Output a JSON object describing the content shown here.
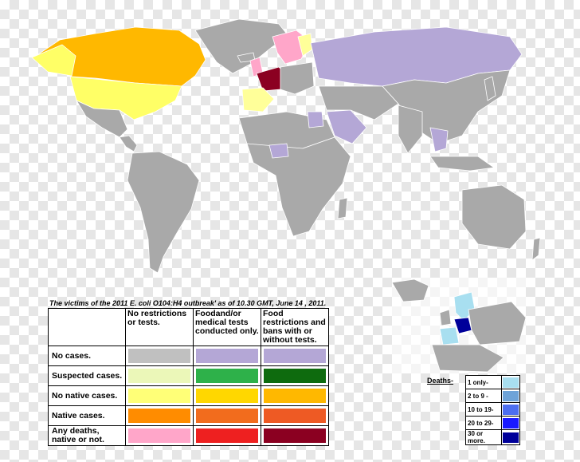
{
  "legend": {
    "caption": "The victims of the  2011 E. coli O104:H4 outbreak' as of 10.30 GMT, June 14 , 2011.",
    "columns": [
      "No restrictions or tests.",
      "Foodand/or medical tests conducted only.",
      "Food restrictions and bans with or without tests."
    ],
    "rows": [
      {
        "label": "No cases.",
        "colors": [
          "#c0c0c0",
          "#b4a7d6",
          "#b4a7d6"
        ]
      },
      {
        "label": "Suspected cases.",
        "colors": [
          "#ebf7b8",
          "#2eb14a",
          "#0e6b0e"
        ]
      },
      {
        "label": "No native cases.",
        "colors": [
          "#ffff77",
          "#ffd700",
          "#ffb800"
        ]
      },
      {
        "label": "Native cases.",
        "colors": [
          "#ff8c00",
          "#f26c1d",
          "#ee5a24"
        ]
      },
      {
        "label": "Any deaths, native or not.",
        "colors": [
          "#ffa6c9",
          "#ee2020",
          "#8b0021"
        ]
      }
    ]
  },
  "deaths": {
    "label": "Deaths-",
    "items": [
      {
        "label": "1 only-",
        "color": "#a8dff0"
      },
      {
        "label": "2 to 9 -",
        "color": "#6ea3d8"
      },
      {
        "label": "10 to 19-",
        "color": "#4c6ef0"
      },
      {
        "label": "20 to 29-",
        "color": "#1a1aff"
      },
      {
        "label": "30 or more.",
        "color": "#00009a"
      }
    ]
  },
  "map_colors": {
    "no_cases": "#a9a9a9",
    "lavender": "#b4a7d6",
    "yellow": "#ffff66",
    "orange": "#ffb800",
    "dark_red": "#8b0021",
    "light_yellow": "#ffff99",
    "pink": "#ffa6c9"
  }
}
